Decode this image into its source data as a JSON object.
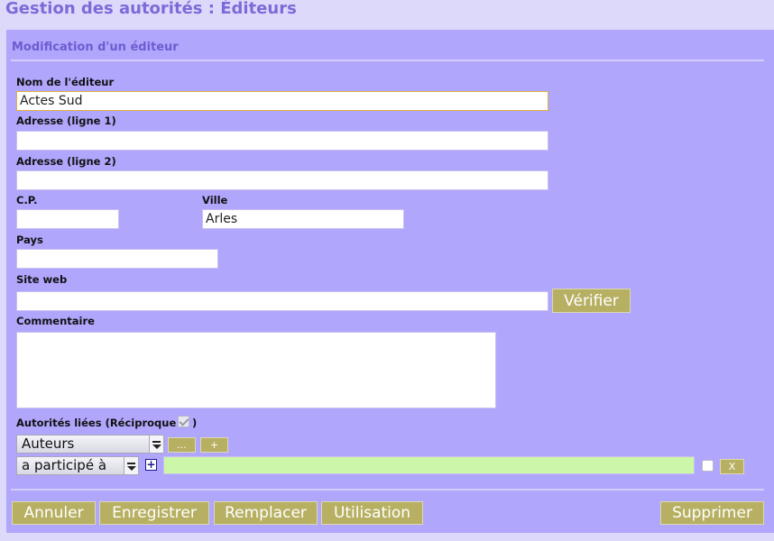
{
  "page": {
    "title": "Gestion des autorités : Éditeurs"
  },
  "form": {
    "title": "Modification d'un éditeur",
    "fields": {
      "nom": {
        "label": "Nom de l'éditeur",
        "value": "Actes Sud"
      },
      "adresse1": {
        "label": "Adresse (ligne 1)",
        "value": ""
      },
      "adresse2": {
        "label": "Adresse (ligne 2)",
        "value": ""
      },
      "cp": {
        "label": "C.P.",
        "value": ""
      },
      "ville": {
        "label": "Ville",
        "value": "Arles"
      },
      "pays": {
        "label": "Pays",
        "value": ""
      },
      "site": {
        "label": "Site web",
        "value": ""
      },
      "commentaire": {
        "label": "Commentaire",
        "value": ""
      }
    },
    "verify_label": "Vérifier",
    "linked": {
      "label": "Autorités liées (Réciproque",
      "label_close": ")",
      "reciprocal_checked": true,
      "type_selected": "Auteurs",
      "relation_selected": "a participé à",
      "browse_label": "...",
      "add_label": "+",
      "plus_glyph": "+",
      "remove_label": "X",
      "value": ""
    },
    "actions": {
      "cancel": "Annuler",
      "save": "Enregistrer",
      "replace": "Remplacer",
      "usage": "Utilisation",
      "delete": "Supprimer"
    }
  },
  "colors": {
    "background": "#ddd9fb",
    "panel": "#b0a6fc",
    "title": "#7d6ad8",
    "button": "#b7b063",
    "link_input": "#ccf7a8"
  }
}
